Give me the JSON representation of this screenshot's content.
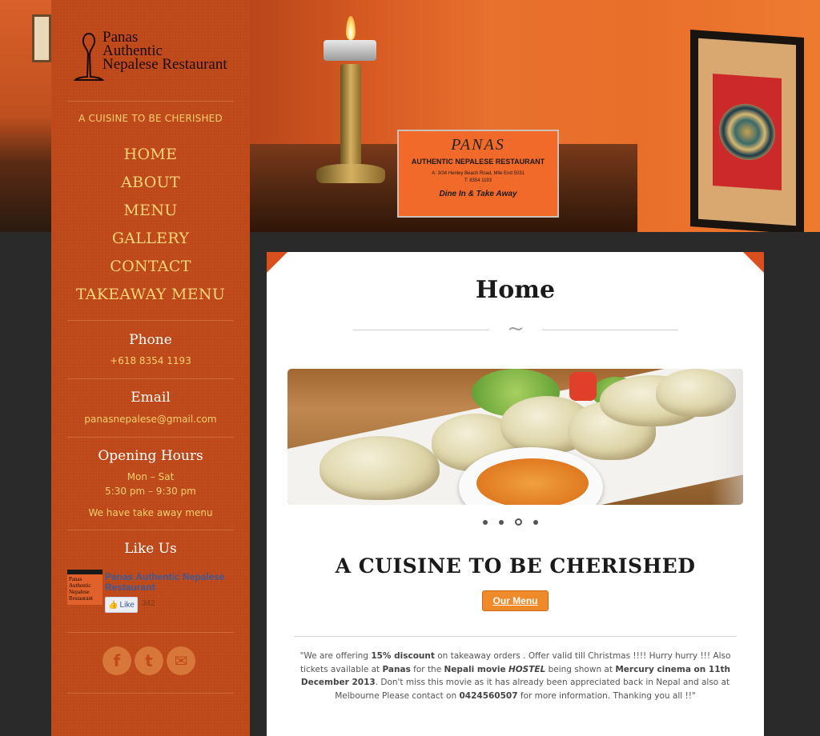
{
  "brand": {
    "logo_line1": "Panas",
    "logo_line2": "Authentic",
    "logo_line3": "Nepalese Restaurant",
    "tagline": "A CUISINE TO BE CHERISHED"
  },
  "hero_card": {
    "name": "PANAS",
    "subtitle": "AUTHENTIC NEPALESE RESTAURANT",
    "address": "A: 3/34 Henley Beach Road, Mile End 5031",
    "phone": "T: 8354 1193",
    "tagline": "Dine In & Take Away"
  },
  "nav": {
    "items": [
      {
        "label": "HOME"
      },
      {
        "label": "ABOUT"
      },
      {
        "label": "MENU"
      },
      {
        "label": "GALLERY"
      },
      {
        "label": "CONTACT"
      },
      {
        "label": "TAKEAWAY MENU"
      }
    ]
  },
  "contact": {
    "phone_heading": "Phone",
    "phone": "+618 8354 1193",
    "email_heading": "Email",
    "email": "panasnepalese@gmail.com",
    "hours_heading": "Opening Hours",
    "days": "Mon – Sat",
    "hours": "5:30 pm – 9:30 pm",
    "takeaway_note": "We have take away menu"
  },
  "social": {
    "heading": "Like Us",
    "fb_page_name": "Panas Authentic Nepalese Restaurant",
    "fb_like_label": "Like",
    "fb_like_count": "342",
    "thumb_text": "Panas Authentic Nepalese Restaurant",
    "icons": [
      "facebook-icon",
      "twitter-icon",
      "email-icon"
    ],
    "icon_glyphs": [
      "f",
      "t",
      "✉"
    ]
  },
  "main": {
    "page_title": "Home",
    "swirl": "~",
    "headline": "A CUISINE TO BE CHERISHED",
    "button_label": "Our Menu",
    "slider_active_index": 2,
    "slider_count": 4,
    "notice": {
      "p1": "\"We are offering ",
      "b1": "15% discount",
      "p2": " on takeaway orders . Offer valid till Christmas !!!! Hurry hurry !!! Also tickets available at ",
      "b2": "Panas",
      "p3": " for the ",
      "b3": "Nepali movie",
      "b3i": "HOSTEL",
      "p4": " being shown at ",
      "b4": "Mercury cinema on 11th December 2013",
      "p5": ". Don't miss this movie as it has already been appreciated back in Nepal and also at Melbourne Please contact on ",
      "b5": "0424560507",
      "p6": " for more information. Thanking you all !!\""
    }
  },
  "colors": {
    "sidebar": "#c24a1a",
    "nav_text": "#f9d67a",
    "accent": "#ee8a2a",
    "corner": "#d94f1e"
  }
}
